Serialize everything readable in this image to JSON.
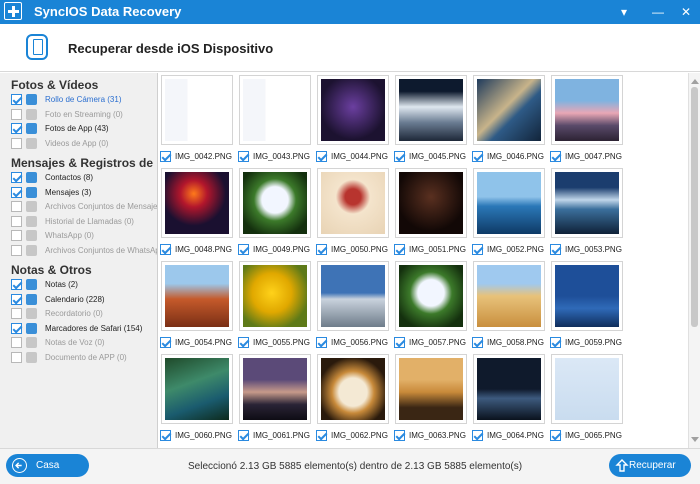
{
  "window": {
    "title": "SyncIOS Data Recovery",
    "menu_glyph": "▾",
    "minimize_glyph": "—",
    "close_glyph": "✕"
  },
  "header": {
    "title": "Recuperar desde iOS Dispositivo",
    "icon": "phone-icon"
  },
  "sidebar": {
    "sections": [
      {
        "title": "Fotos & Vídeos",
        "items": [
          {
            "label": "Rollo de Cámera (31)",
            "checked": true,
            "active": true,
            "selected": true,
            "icon": "camera-icon"
          },
          {
            "label": "Foto en Streaming (0)",
            "checked": false,
            "active": false,
            "selected": false,
            "icon": "photo-icon"
          },
          {
            "label": "Fotos de App (43)",
            "checked": true,
            "active": true,
            "selected": false,
            "icon": "photo-icon"
          },
          {
            "label": "Videos de App (0)",
            "checked": false,
            "active": false,
            "selected": false,
            "icon": "video-icon"
          }
        ]
      },
      {
        "title": "Mensajes & Registros de l...",
        "items": [
          {
            "label": "Contactos (8)",
            "checked": true,
            "active": true,
            "selected": false,
            "icon": "contacts-icon"
          },
          {
            "label": "Mensajes (3)",
            "checked": true,
            "active": true,
            "selected": false,
            "icon": "message-icon"
          },
          {
            "label": "Archivos Conjuntos de Mensajes",
            "checked": false,
            "active": false,
            "selected": false,
            "icon": "attachment-icon"
          },
          {
            "label": "Historial de Llamadas (0)",
            "checked": false,
            "active": false,
            "selected": false,
            "icon": "phone-call-icon"
          },
          {
            "label": "WhatsApp (0)",
            "checked": false,
            "active": false,
            "selected": false,
            "icon": "whatsapp-icon"
          },
          {
            "label": "Archivos Conjuntos de WhatsApp",
            "checked": false,
            "active": false,
            "selected": false,
            "icon": "attachment-icon"
          }
        ]
      },
      {
        "title": "Notas & Otros",
        "items": [
          {
            "label": "Notas (2)",
            "checked": true,
            "active": true,
            "selected": false,
            "icon": "notes-icon"
          },
          {
            "label": "Calendario (228)",
            "checked": true,
            "active": true,
            "selected": false,
            "icon": "calendar-icon"
          },
          {
            "label": "Recordatorio (0)",
            "checked": false,
            "active": false,
            "selected": false,
            "icon": "reminder-icon"
          },
          {
            "label": "Marcadores de Safari (154)",
            "checked": true,
            "active": true,
            "selected": false,
            "icon": "bookmark-icon"
          },
          {
            "label": "Notas de Voz (0)",
            "checked": false,
            "active": false,
            "selected": false,
            "icon": "microphone-icon"
          },
          {
            "label": "Documento de APP (0)",
            "checked": false,
            "active": false,
            "selected": false,
            "icon": "document-icon"
          }
        ]
      }
    ]
  },
  "grid": {
    "items": [
      {
        "name": "IMG_0042.PNG",
        "checked": true,
        "scene": "settings-screenshot"
      },
      {
        "name": "IMG_0043.PNG",
        "checked": true,
        "scene": "settings-screenshot"
      },
      {
        "name": "IMG_0044.PNG",
        "checked": true,
        "scene": "ipad-home-screen"
      },
      {
        "name": "IMG_0045.PNG",
        "checked": true,
        "scene": "clouds-mountains"
      },
      {
        "name": "IMG_0046.PNG",
        "checked": true,
        "scene": "aerial-coastline"
      },
      {
        "name": "IMG_0047.PNG",
        "checked": true,
        "scene": "stonehenge-sunset"
      },
      {
        "name": "IMG_0048.PNG",
        "checked": true,
        "scene": "fireworks-opera-house"
      },
      {
        "name": "IMG_0049.PNG",
        "checked": true,
        "scene": "white-hydrangea"
      },
      {
        "name": "IMG_0050.PNG",
        "checked": true,
        "scene": "cartoon-girl"
      },
      {
        "name": "IMG_0051.PNG",
        "checked": true,
        "scene": "pirates-poster"
      },
      {
        "name": "IMG_0052.PNG",
        "checked": true,
        "scene": "sydney-harbour"
      },
      {
        "name": "IMG_0053.PNG",
        "checked": true,
        "scene": "mountain-lake"
      },
      {
        "name": "IMG_0054.PNG",
        "checked": true,
        "scene": "red-rock-canyon"
      },
      {
        "name": "IMG_0055.PNG",
        "checked": true,
        "scene": "yellow-tulips"
      },
      {
        "name": "IMG_0056.PNG",
        "checked": true,
        "scene": "modern-building"
      },
      {
        "name": "IMG_0057.PNG",
        "checked": true,
        "scene": "white-hydrangea"
      },
      {
        "name": "IMG_0058.PNG",
        "checked": true,
        "scene": "desert-dunes"
      },
      {
        "name": "IMG_0059.PNG",
        "checked": true,
        "scene": "girl-by-sea"
      },
      {
        "name": "IMG_0060.PNG",
        "checked": true,
        "scene": "green-river"
      },
      {
        "name": "IMG_0061.PNG",
        "checked": true,
        "scene": "boats-at-dusk"
      },
      {
        "name": "IMG_0062.PNG",
        "checked": true,
        "scene": "cake"
      },
      {
        "name": "IMG_0063.PNG",
        "checked": true,
        "scene": "pier-sunset"
      },
      {
        "name": "IMG_0064.PNG",
        "checked": true,
        "scene": "night-seascape"
      },
      {
        "name": "IMG_0065.PNG",
        "checked": true,
        "scene": "image-placeholder"
      }
    ]
  },
  "footer": {
    "home_label": "Casa",
    "status": "Seleccionó 2.13 GB 5885 elemento(s) dentro de 2.13 GB 5885 elemento(s)",
    "recover_label": "Recuperar"
  },
  "colors": {
    "titlebar": "#1a84d6",
    "accent": "#1a84d6",
    "checkbox": "#2a8ae0",
    "selected_text": "#2b6fd0",
    "disabled_text": "#9a9a9a"
  }
}
